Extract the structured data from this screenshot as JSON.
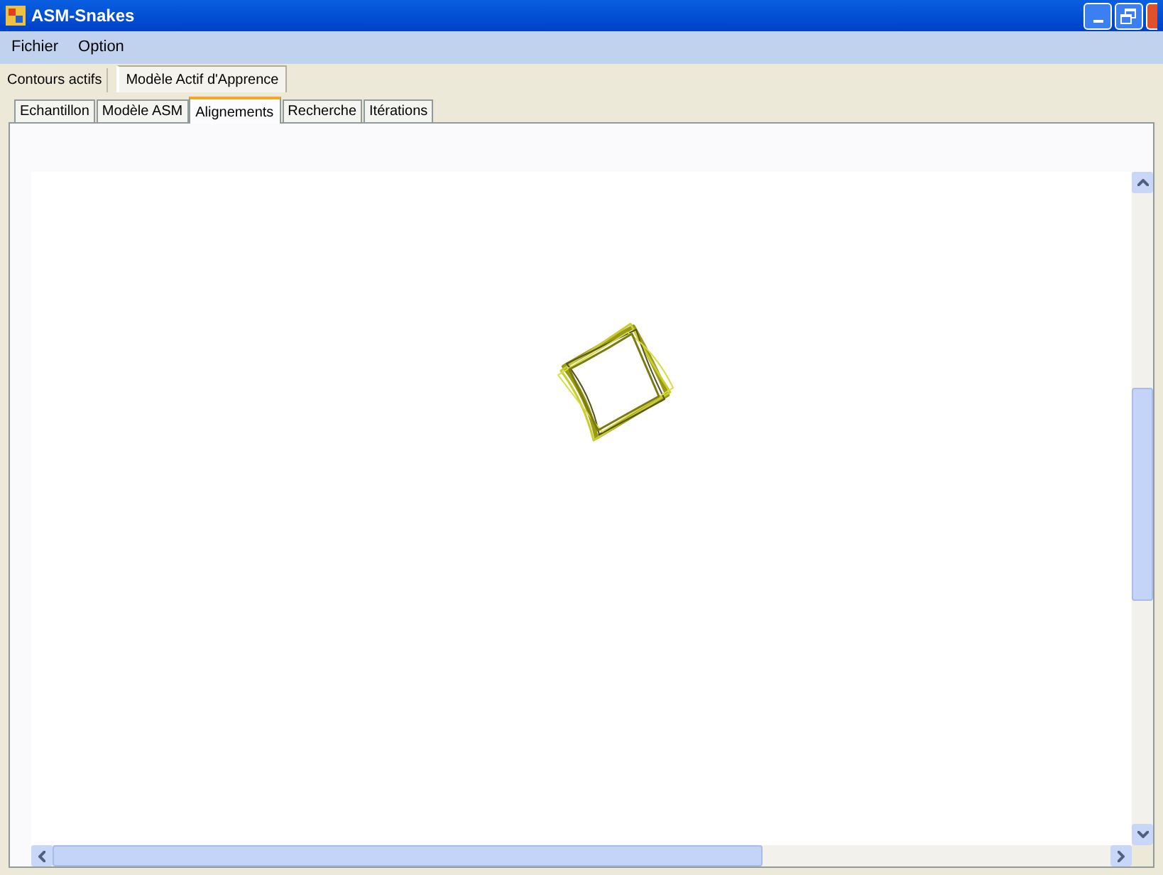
{
  "window": {
    "title": "ASM-Snakes"
  },
  "menu": [
    "Fichier",
    "Option"
  ],
  "main_tabs": [
    {
      "label": "Contours actifs",
      "selected": false
    },
    {
      "label": "Modèle Actif d'Apprence",
      "selected": true
    }
  ],
  "sub_tabs": [
    {
      "label": "Echantillon",
      "selected": false
    },
    {
      "label": "Modèle ASM",
      "selected": false
    },
    {
      "label": "Alignements",
      "selected": true
    },
    {
      "label": "Recherche",
      "selected": false
    },
    {
      "label": "Itérations",
      "selected": false
    }
  ]
}
